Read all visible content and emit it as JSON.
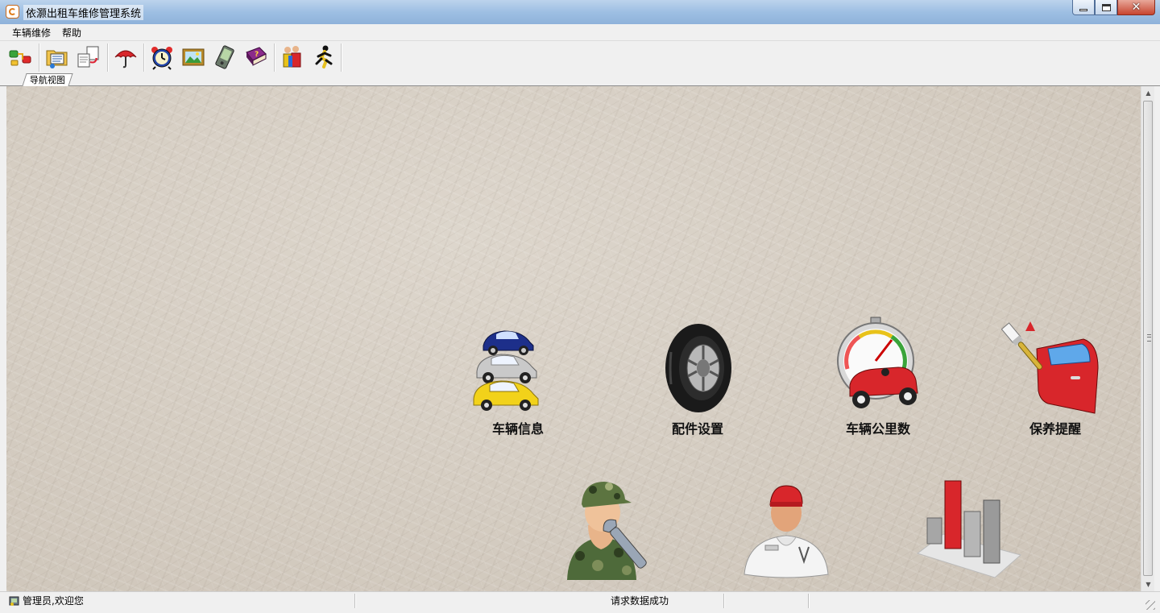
{
  "window": {
    "title": "依灏出租车维修管理系统",
    "app_icon": "app-logo-icon"
  },
  "menubar": {
    "items": [
      "车辆维修",
      "帮助"
    ]
  },
  "toolbar": {
    "buttons": [
      {
        "name": "connect-icon"
      },
      {
        "name": "folder-list-icon"
      },
      {
        "name": "exchange-docs-icon"
      },
      {
        "name": "umbrella-icon"
      },
      {
        "name": "alarm-clock-icon"
      },
      {
        "name": "picture-frame-icon"
      },
      {
        "name": "pda-icon"
      },
      {
        "name": "help-book-icon"
      },
      {
        "name": "users-icon"
      },
      {
        "name": "exit-runner-icon"
      }
    ]
  },
  "tabs": [
    {
      "label": "导航视图"
    }
  ],
  "nav": {
    "items": [
      {
        "label": "车辆信息",
        "icon": "cars-icon"
      },
      {
        "label": "配件设置",
        "icon": "tire-icon"
      },
      {
        "label": "车辆公里数",
        "icon": "speedometer-car-icon"
      },
      {
        "label": "保养提醒",
        "icon": "paint-door-icon"
      },
      {
        "label": "",
        "icon": "mechanic-soldier-icon"
      },
      {
        "label": "",
        "icon": "repairman-icon"
      },
      {
        "label": "",
        "icon": "bar-chart-icon"
      }
    ]
  },
  "statusbar": {
    "user_text": "管理员,欢迎您",
    "message": "请求数据成功"
  },
  "colors": {
    "titlebar": "#9ebfe3",
    "chrome": "#f0f0f0",
    "background": "#d3cbc1"
  }
}
